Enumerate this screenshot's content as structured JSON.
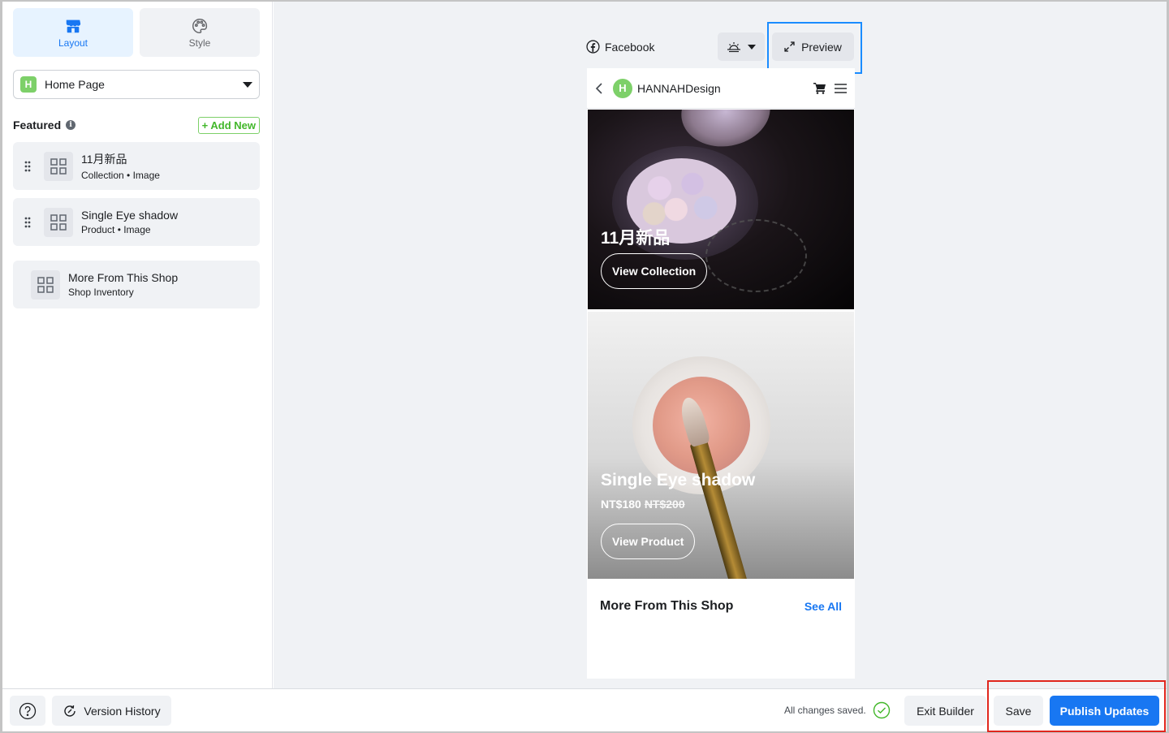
{
  "sidebar": {
    "tabs": [
      {
        "label": "Layout",
        "icon": "store-icon",
        "active": true
      },
      {
        "label": "Style",
        "icon": "palette-icon",
        "active": false
      }
    ],
    "page_select": {
      "badge": "H",
      "value": "Home Page"
    },
    "featured": {
      "title": "Featured",
      "add_new": "+ Add New"
    },
    "items": [
      {
        "title": "11月新品",
        "subtitle": "Collection • Image"
      },
      {
        "title": "Single Eye shadow",
        "subtitle": "Product • Image"
      },
      {
        "title": "More From This Shop",
        "subtitle": "Shop Inventory"
      }
    ]
  },
  "canvas": {
    "platform": "Facebook",
    "preview_label": "Preview",
    "shop": {
      "avatar": "H",
      "name": "HANNAHDesign"
    },
    "hero": {
      "title": "11月新品",
      "button": "View Collection"
    },
    "product": {
      "title": "Single Eye shadow",
      "price": "NT$180",
      "old_price": "NT$200",
      "button": "View Product"
    },
    "more": {
      "title": "More From This Shop",
      "see_all": "See All"
    }
  },
  "bottom": {
    "version_history": "Version History",
    "saved_status": "All changes saved.",
    "exit": "Exit Builder",
    "save": "Save",
    "publish": "Publish Updates"
  },
  "colors": {
    "accent": "#1877f2",
    "green": "#7dd069",
    "highlight_blue": "#1a8cff",
    "highlight_red": "#e0261d"
  }
}
